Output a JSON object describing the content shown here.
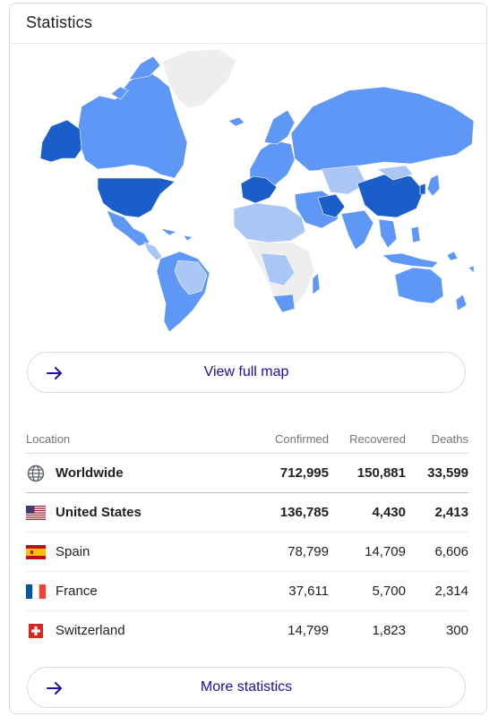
{
  "card": {
    "title": "Statistics"
  },
  "map": {
    "name": "world-map",
    "land_color": "#5e97f6",
    "dark_color": "#1c5ec9",
    "light_color": "#a9c6f5",
    "nodata_color": "#eeeeee"
  },
  "buttons": {
    "view_map": "View full map",
    "more_stats": "More statistics"
  },
  "table": {
    "headers": {
      "location": "Location",
      "confirmed": "Confirmed",
      "recovered": "Recovered",
      "deaths": "Deaths"
    },
    "rows": [
      {
        "location": "Worldwide",
        "icon": "globe-icon",
        "confirmed": "712,995",
        "recovered": "150,881",
        "deaths": "33,599"
      },
      {
        "location": "United States",
        "icon": "us-flag-icon",
        "confirmed": "136,785",
        "recovered": "4,430",
        "deaths": "2,413"
      },
      {
        "location": "Spain",
        "icon": "spain-flag-icon",
        "confirmed": "78,799",
        "recovered": "14,709",
        "deaths": "6,606"
      },
      {
        "location": "France",
        "icon": "france-flag-icon",
        "confirmed": "37,611",
        "recovered": "5,700",
        "deaths": "2,314"
      },
      {
        "location": "Switzerland",
        "icon": "switzerland-flag-icon",
        "confirmed": "14,799",
        "recovered": "1,823",
        "deaths": "300"
      }
    ]
  },
  "colors": {
    "link": "#1a0dab",
    "muted": "#70757a",
    "border": "#dadce0"
  }
}
